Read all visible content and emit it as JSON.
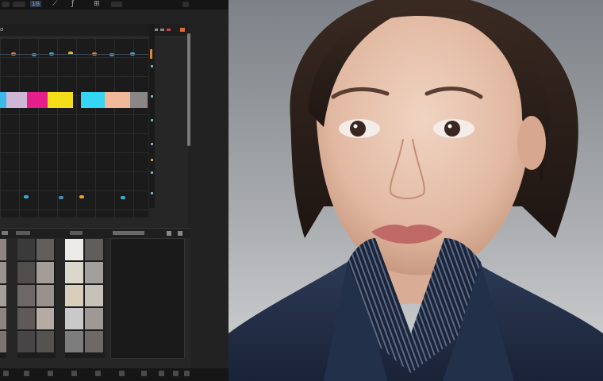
{
  "toolbar": {
    "badge": "1G",
    "icons": [
      "brush-icon",
      "pen-icon",
      "grid-icon"
    ],
    "icon_glyphs": [
      "⟋",
      "ƒ",
      "⊞"
    ]
  },
  "editor_panel": {
    "title": "o",
    "accent_color": "#e06a2e"
  },
  "swatches": {
    "top_row": [
      "#3ab8e8",
      "#cdb6d6",
      "#e61e8c",
      "#f4de1a",
      "#35d6f4",
      "#f2b89a",
      "#8b8686"
    ]
  },
  "palette": {
    "column_1": [
      "#8f8480",
      "#9b918e",
      "#a59e9b",
      "#8d837f",
      "#7d7470"
    ],
    "column_2": [
      "#3b3a3a",
      "#625e5b",
      "#514d4b",
      "#a39c97",
      "#6d6866",
      "#98918d",
      "#5f5a58",
      "#b5aba4",
      "#474545",
      "#555252"
    ],
    "column_3": [
      "#ecebe7",
      "#5f5e5d",
      "#dcd7cd",
      "#a19f9d",
      "#d9cdbc",
      "#c7c1b9",
      "#c9c9c9",
      "#9f9894",
      "#7d7d7d",
      "#6e6967"
    ]
  },
  "image": {
    "description_icon": "portrait-photo"
  }
}
